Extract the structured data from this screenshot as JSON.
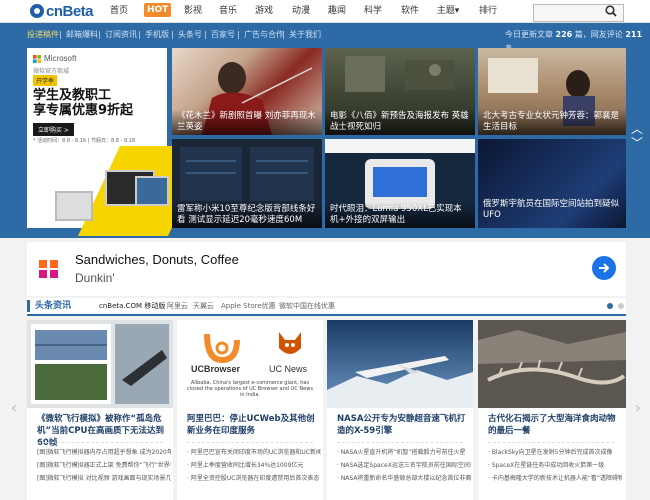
{
  "logo": {
    "text": "cnBeta"
  },
  "top_nav": {
    "items": [
      "首页",
      "HOT",
      "影视",
      "音乐",
      "游戏",
      "动漫",
      "趣闻",
      "科学",
      "软件",
      "主题",
      "排行"
    ],
    "theme_arrow": "▾"
  },
  "search": {
    "placeholder": ""
  },
  "sub_nav": {
    "items": [
      "投递稿件",
      "邮箱爆料",
      "订阅资讯",
      "手机版",
      "头条号",
      "百家号",
      "广告与合作",
      "关于我们"
    ],
    "separator": "|"
  },
  "stats": {
    "today_label": "今日更新文章",
    "today_count": "226",
    "today_unit": "篇，网友评论",
    "comments": "211",
    "comments_unit": "条"
  },
  "ms_ad": {
    "brand": "Microsoft",
    "subbrand": "微软官方商城",
    "tag": "开学季",
    "headline_1": "学生及教职工",
    "headline_2": "享专属优惠9折起",
    "button": "立即购买 >",
    "note": "* 活动时间：8.8 - 8.16 | 节假日：8.8 - 8.18"
  },
  "featured": [
    {
      "caption": "《花木兰》新剧照首曝 刘亦菲再现木兰英姿"
    },
    {
      "caption": "电影《八佰》新预告及海报发布 英雄战士视死如归"
    },
    {
      "caption": "北大考古专业女状元钟芳蓉：郭襄是生活目标"
    },
    {
      "caption": "雷军称小米10至尊纪念版背部线条好看 测试显示延迟20毫秒速度60M"
    },
    {
      "caption": "时代眼泪：Lumia 950XL已实现本机+外接的双屏输出"
    },
    {
      "caption": "俄罗斯宇航员在国际空间站拍到疑似UFO"
    }
  ],
  "dunkin_ad": {
    "logo": "DNKN",
    "title": "Sandwiches, Donuts, Coffee",
    "subtitle": "Dunkin'"
  },
  "headlines": {
    "title": "头条资讯",
    "links": [
      "cnBeta.COM 移动版",
      "阿里云",
      "天翼云",
      "Apple Store优惠",
      "微软中国在线优惠"
    ]
  },
  "cards": [
    {
      "title": "《微软飞行模拟》被称作“孤岛危机”当前CPU在高画质下无法达到60帧",
      "items": [
        "[图]微软飞行模拟器内存占用超乎想象 成为2020年升分最",
        "[图]微软飞行模拟器正式上架 免费帮你“飞行”世界各地",
        "[图]微软飞行模拟 对比视频 游戏画面与现实场景几乎一模"
      ]
    },
    {
      "title": "阿里巴巴：停止UCWeb及其他创新业务在印度服务",
      "image_caption": "Alibaba, China's largest e-commerce giant, has closed the operations of UC Browser and UC News in India.",
      "uc_left": "UCBrowser",
      "uc_right": "UC News",
      "items": [
        "· 阿里巴巴宣布关闭印度市场的UC浏览器和UC新闻",
        "· 阿里上季度营收同比增长34%达1009亿元",
        "· 阿里全资控股UC浏览器在印度遭禁用后首次表态"
      ]
    },
    {
      "title": "NASA公开专为安静超音速飞机打造的X-59引擎",
      "items": [
        "· NASA火星直升机将“机智”搭载毅力号前往火星",
        "· NASA选定SpaceX运送三名宇航员前往国际空间站",
        "· NASA将重新命名华盛顿总部大楼以纪念首位非裔女工"
      ]
    },
    {
      "title": "古代化石揭示了大型海洋食肉动物的最后一餐",
      "items": [
        "· BlackSky向卫星在发射5分钟后完成首次成像",
        "· SpaceX在星链任务中成功回收火箭第一级",
        "· 卡内基梅隆大学的新技术让机器人能“看”透障碍物"
      ]
    }
  ],
  "colors": {
    "brand_blue": "#2d6aa6",
    "hot": "#f38b2a",
    "ms_yellow": "#f5d400",
    "dunkin_orange": "#ff671f",
    "dunkin_pink": "#da1884"
  }
}
